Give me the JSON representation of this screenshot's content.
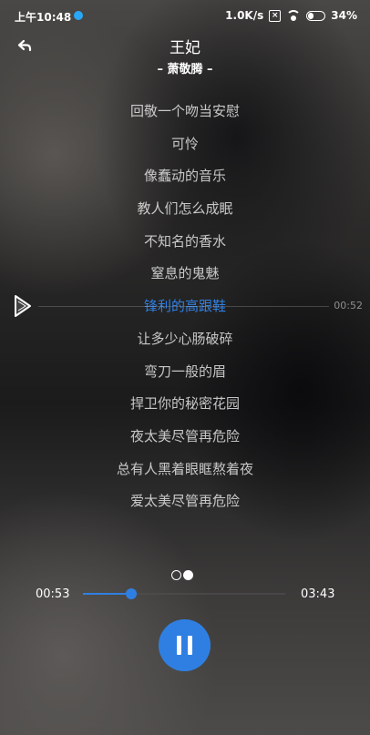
{
  "status_bar": {
    "time": "上午10:48",
    "network_speed": "1.0K/s",
    "battery": "34%",
    "battery_level": 0.34,
    "icons": [
      "notification-dot-icon",
      "sim-off-icon",
      "wifi-icon",
      "battery-icon"
    ]
  },
  "header": {
    "song_title": "王妃",
    "artist": "– 萧敬腾 –"
  },
  "lyrics": [
    "回敬一个吻当安慰",
    "可怜",
    "像蠢动的音乐",
    "教人们怎么成眠",
    "不知名的香水",
    "窒息的鬼魅",
    "锋利的高跟鞋",
    "让多少心肠破碎",
    "弯刀一般的眉",
    "捍卫你的秘密花园",
    "夜太美尽管再危险",
    "总有人黑着眼眶熬着夜",
    "爱太美尽管再危险"
  ],
  "active_lyric_index": 6,
  "seek_preview_time": "00:52",
  "player": {
    "current_time": "00:53",
    "duration": "03:43",
    "progress": 0.24
  },
  "colors": {
    "accent": "#2f7fe3",
    "lyric_text": "#ebebeb"
  }
}
